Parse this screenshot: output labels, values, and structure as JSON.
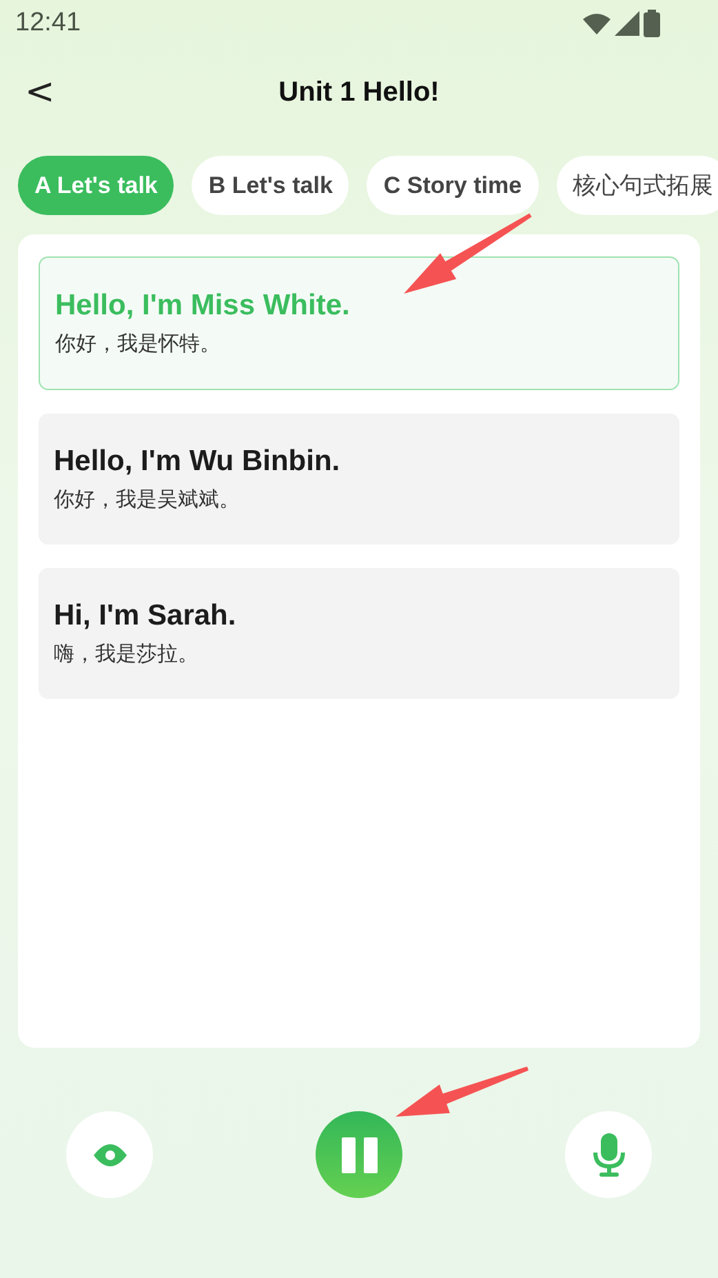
{
  "status_bar": {
    "time": "12:41"
  },
  "header": {
    "back": "<",
    "title": "Unit 1 Hello!"
  },
  "tabs": [
    {
      "label": "A Let's talk",
      "selected": true
    },
    {
      "label": "B Let's talk",
      "selected": false
    },
    {
      "label": "C Story time",
      "selected": false
    },
    {
      "label": "核心句式拓展",
      "selected": false
    }
  ],
  "sentences": [
    {
      "english": "Hello, I'm Miss White.",
      "chinese": "你好，我是怀特。",
      "selected": true
    },
    {
      "english": "Hello, I'm Wu Binbin.",
      "chinese": "你好，我是吴斌斌。",
      "selected": false
    },
    {
      "english": "Hi, I'm Sarah.",
      "chinese": "嗨，我是莎拉。",
      "selected": false
    }
  ],
  "controls": {
    "playing": true
  }
}
